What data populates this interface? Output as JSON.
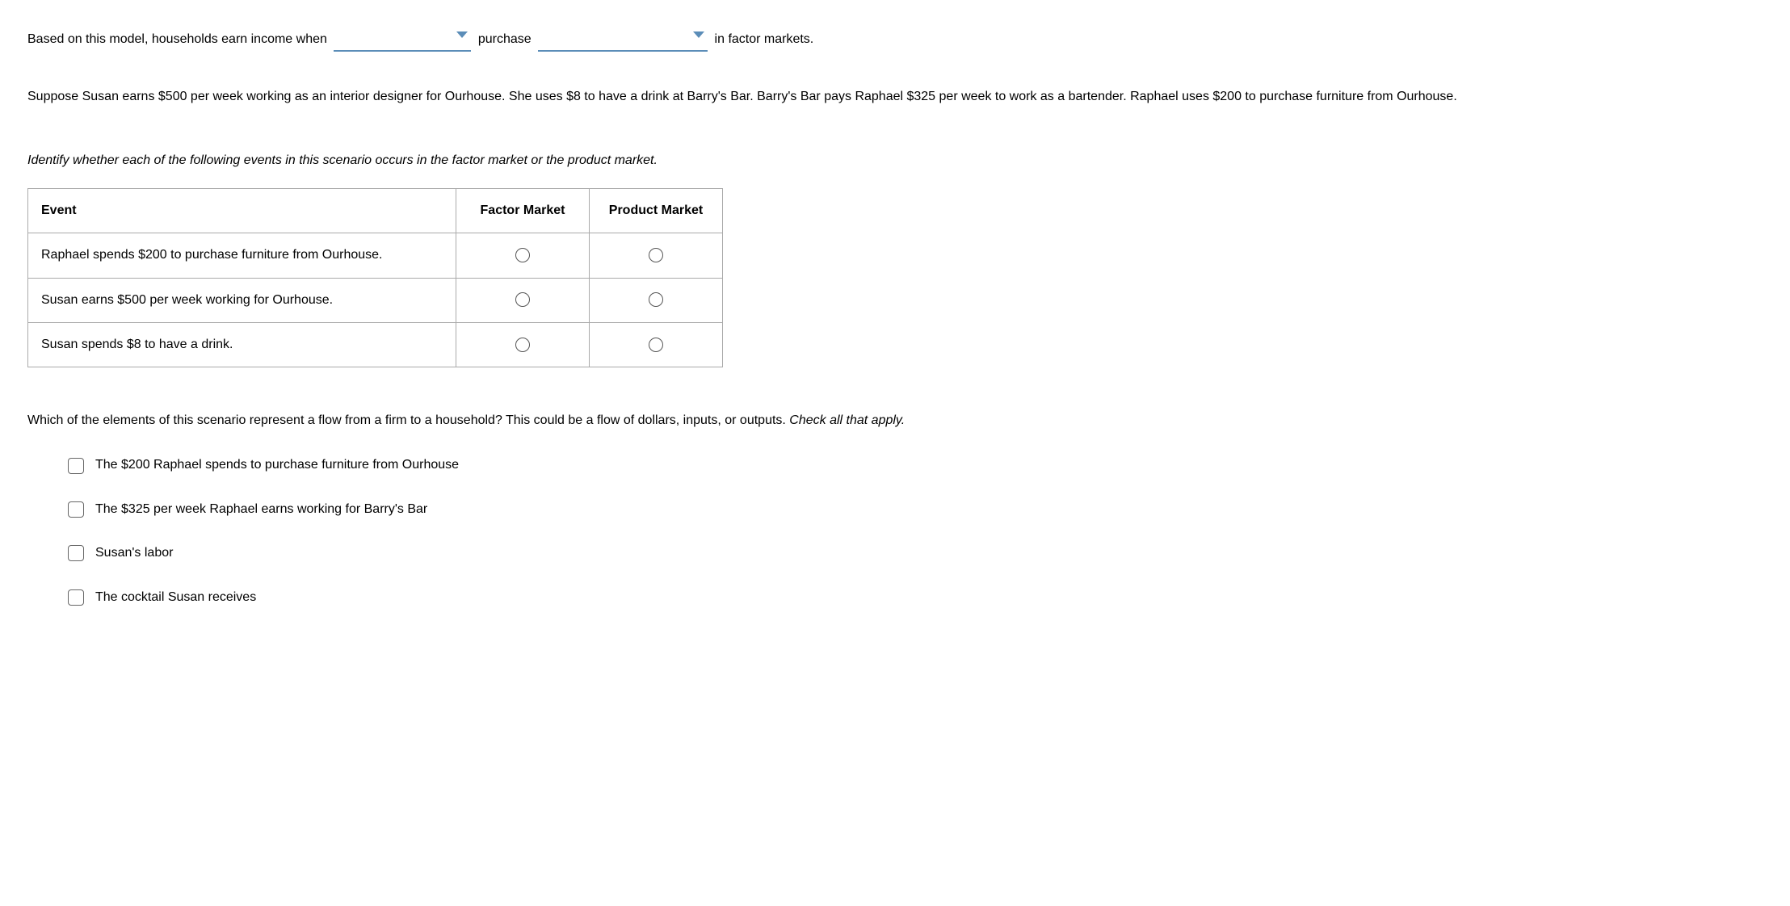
{
  "sentence": {
    "part1": "Based on this model, households earn income when",
    "part2": "purchase",
    "part3": "in factor markets."
  },
  "paragraph": "Suppose Susan earns $500 per week working as an interior designer for Ourhouse. She uses $8 to have a drink at Barry's Bar. Barry's Bar pays Raphael $325 per week to work as a bartender. Raphael uses $200 to purchase furniture from Ourhouse.",
  "instruction1": "Identify whether each of the following events in this scenario occurs in the factor market or the product market.",
  "table": {
    "headers": {
      "event": "Event",
      "factor": "Factor Market",
      "product": "Product Market"
    },
    "rows": [
      {
        "event": "Raphael spends $200 to purchase furniture from Ourhouse."
      },
      {
        "event": "Susan earns $500 per week working for Ourhouse."
      },
      {
        "event": "Susan spends $8 to have a drink."
      }
    ]
  },
  "question2": {
    "text": "Which of the elements of this scenario represent a flow from a firm to a household? This could be a flow of dollars, inputs, or outputs. ",
    "em": "Check all that apply."
  },
  "checks": [
    "The $200 Raphael spends to purchase furniture from Ourhouse",
    "The $325 per week Raphael earns working for Barry's Bar",
    "Susan's labor",
    "The cocktail Susan receives"
  ]
}
